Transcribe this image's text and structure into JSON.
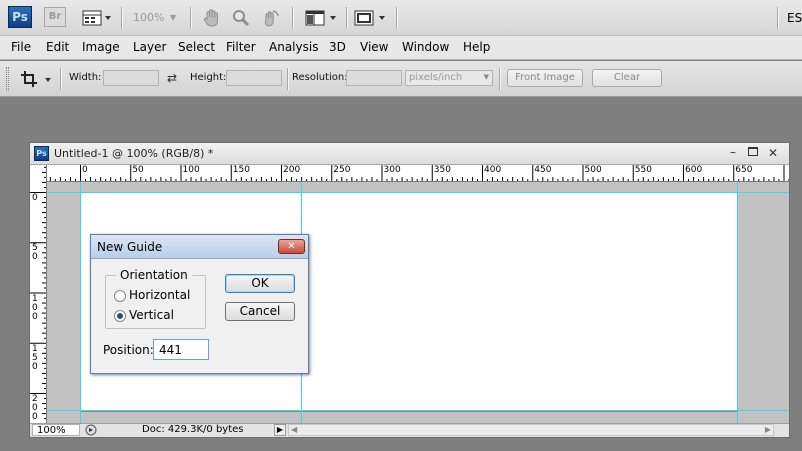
{
  "app": {
    "logo": "Ps",
    "bridge_logo": "Br",
    "zoom_level": "100%",
    "workspace_label": "ES",
    "icons": [
      "launch-bridge-icon",
      "view-extras-icon",
      "hand-tool-icon",
      "zoom-tool-icon",
      "rotate-view-icon",
      "arrange-documents-icon",
      "screen-mode-icon"
    ]
  },
  "menu": {
    "items": [
      "File",
      "Edit",
      "Image",
      "Layer",
      "Select",
      "Filter",
      "Analysis",
      "3D",
      "View",
      "Window",
      "Help"
    ]
  },
  "options_bar": {
    "width_label": "Width:",
    "width_value": "",
    "height_label": "Height:",
    "height_value": "",
    "resolution_label": "Resolution:",
    "resolution_value": "",
    "resolution_unit": "pixels/inch",
    "front_image_label": "Front Image",
    "clear_label": "Clear"
  },
  "document": {
    "title": "Untitled-1 @ 100% (RGB/8) *",
    "hruler_labels": [
      "0",
      "50",
      "100",
      "150",
      "200",
      "250",
      "300",
      "350",
      "400",
      "450",
      "500",
      "550",
      "600",
      "650"
    ],
    "vruler_labels": [
      [
        "0"
      ],
      [
        "5",
        "0"
      ],
      [
        "1",
        "0",
        "0"
      ],
      [
        "1",
        "5",
        "0"
      ],
      [
        "2",
        "0",
        "0"
      ]
    ],
    "status_zoom": "100%",
    "status_doc": "Doc: 429.3K/0 bytes"
  },
  "dialog": {
    "title": "New Guide",
    "close_glyph": "✕",
    "orientation_label": "Orientation",
    "horizontal_label": "Horizontal",
    "vertical_label": "Vertical",
    "selected": "vertical",
    "ok_label": "OK",
    "cancel_label": "Cancel",
    "position_label": "Position:",
    "position_value": "441"
  },
  "colors": {
    "guide": "#3ad7e6",
    "workspace": "#7f7f7f",
    "ps_blue": "#1f5aa0"
  }
}
